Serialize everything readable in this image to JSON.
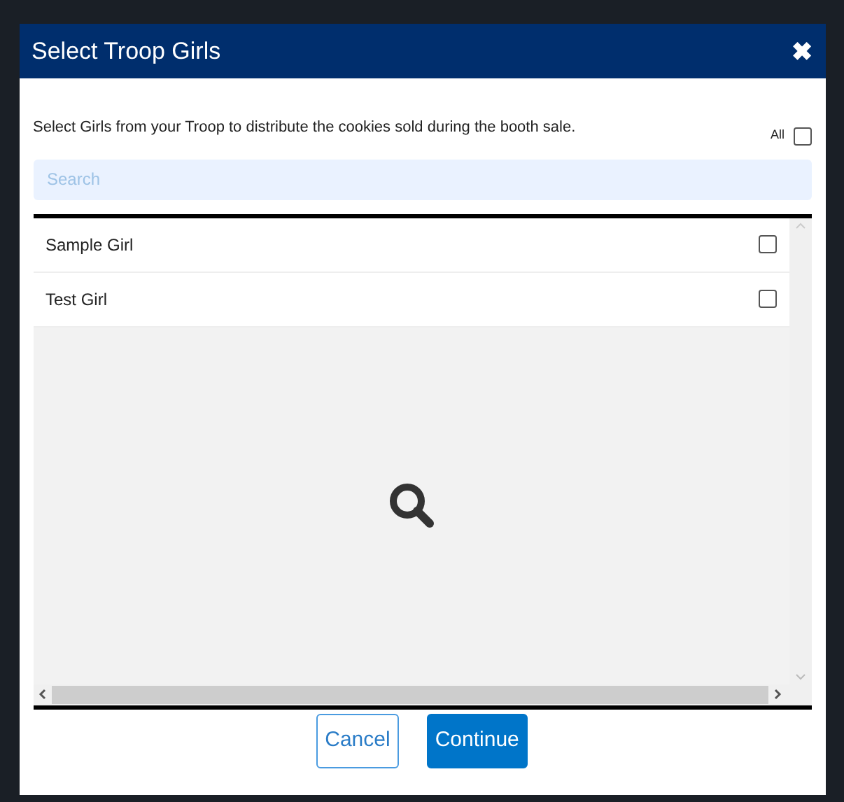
{
  "dialog": {
    "title": "Select Troop Girls",
    "close_symbol": "✖"
  },
  "instructions": "Select Girls from your Troop to distribute the cookies sold during the booth sale.",
  "select_all": {
    "label": "All",
    "checked": false
  },
  "search": {
    "placeholder": "Search"
  },
  "girls": [
    {
      "name": "Sample Girl",
      "checked": false
    },
    {
      "name": "Test Girl",
      "checked": false
    }
  ],
  "buttons": [
    {
      "label": "Cancel",
      "kind": "secondary"
    },
    {
      "label": "Continue",
      "kind": "primary"
    }
  ]
}
